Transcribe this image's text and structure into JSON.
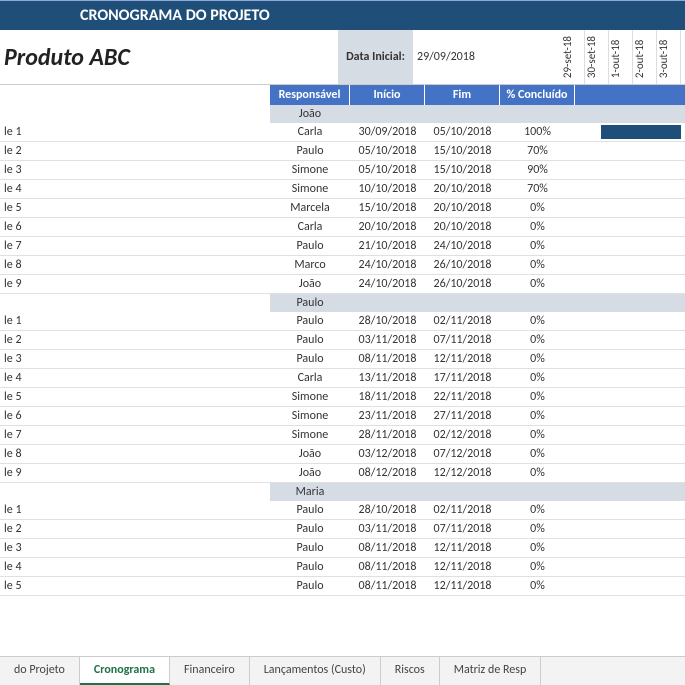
{
  "title": "CRONOGRAMA DO PROJETO",
  "product": "Produto ABC",
  "start_date_label": "Data Inicial:",
  "start_date_value": "29/09/2018",
  "gantt_dates": [
    "29-set-18",
    "30-set-18",
    "1-out-18",
    "2-out-18",
    "3-out-18"
  ],
  "headers": {
    "resp": "Responsável",
    "start": "Início",
    "end": "Fim",
    "pct": "% Concluído"
  },
  "groups": [
    {
      "owner": "João",
      "rows": [
        {
          "task": "le 1",
          "resp": "Carla",
          "start": "30/09/2018",
          "end": "05/10/2018",
          "pct": "100%",
          "bar": true
        },
        {
          "task": "le 2",
          "resp": "Paulo",
          "start": "05/10/2018",
          "end": "15/10/2018",
          "pct": "70%"
        },
        {
          "task": "le 3",
          "resp": "Simone",
          "start": "05/10/2018",
          "end": "15/10/2018",
          "pct": "90%"
        },
        {
          "task": "le 4",
          "resp": "Simone",
          "start": "10/10/2018",
          "end": "20/10/2018",
          "pct": "70%"
        },
        {
          "task": "le 5",
          "resp": "Marcela",
          "start": "15/10/2018",
          "end": "20/10/2018",
          "pct": "0%"
        },
        {
          "task": "le 6",
          "resp": "Carla",
          "start": "20/10/2018",
          "end": "20/10/2018",
          "pct": "0%"
        },
        {
          "task": "le 7",
          "resp": "Paulo",
          "start": "21/10/2018",
          "end": "24/10/2018",
          "pct": "0%"
        },
        {
          "task": "le 8",
          "resp": "Marco",
          "start": "24/10/2018",
          "end": "26/10/2018",
          "pct": "0%"
        },
        {
          "task": "le 9",
          "resp": "João",
          "start": "24/10/2018",
          "end": "26/10/2018",
          "pct": "0%"
        }
      ]
    },
    {
      "owner": "Paulo",
      "rows": [
        {
          "task": "le 1",
          "resp": "Paulo",
          "start": "28/10/2018",
          "end": "02/11/2018",
          "pct": "0%"
        },
        {
          "task": "le 2",
          "resp": "Paulo",
          "start": "03/11/2018",
          "end": "07/11/2018",
          "pct": "0%"
        },
        {
          "task": "le 3",
          "resp": "Paulo",
          "start": "08/11/2018",
          "end": "12/11/2018",
          "pct": "0%"
        },
        {
          "task": "le 4",
          "resp": "Carla",
          "start": "13/11/2018",
          "end": "17/11/2018",
          "pct": "0%"
        },
        {
          "task": "le 5",
          "resp": "Simone",
          "start": "18/11/2018",
          "end": "22/11/2018",
          "pct": "0%"
        },
        {
          "task": "le 6",
          "resp": "Simone",
          "start": "23/11/2018",
          "end": "27/11/2018",
          "pct": "0%"
        },
        {
          "task": "le 7",
          "resp": "Simone",
          "start": "28/11/2018",
          "end": "02/12/2018",
          "pct": "0%"
        },
        {
          "task": "le 8",
          "resp": "João",
          "start": "03/12/2018",
          "end": "07/12/2018",
          "pct": "0%"
        },
        {
          "task": "le 9",
          "resp": "João",
          "start": "08/12/2018",
          "end": "12/12/2018",
          "pct": "0%"
        }
      ]
    },
    {
      "owner": "Maria",
      "rows": [
        {
          "task": "le 1",
          "resp": "Paulo",
          "start": "28/10/2018",
          "end": "02/11/2018",
          "pct": "0%"
        },
        {
          "task": "le 2",
          "resp": "Paulo",
          "start": "03/11/2018",
          "end": "07/11/2018",
          "pct": "0%"
        },
        {
          "task": "le 3",
          "resp": "Paulo",
          "start": "08/11/2018",
          "end": "12/11/2018",
          "pct": "0%"
        },
        {
          "task": "le 4",
          "resp": "Paulo",
          "start": "08/11/2018",
          "end": "12/11/2018",
          "pct": "0%"
        },
        {
          "task": "le 5",
          "resp": "Paulo",
          "start": "08/11/2018",
          "end": "12/11/2018",
          "pct": "0%"
        }
      ]
    }
  ],
  "tabs": [
    "do Projeto",
    "Cronograma",
    "Financeiro",
    "Lançamentos (Custo)",
    "Riscos",
    "Matriz de Resp"
  ],
  "active_tab": 1
}
